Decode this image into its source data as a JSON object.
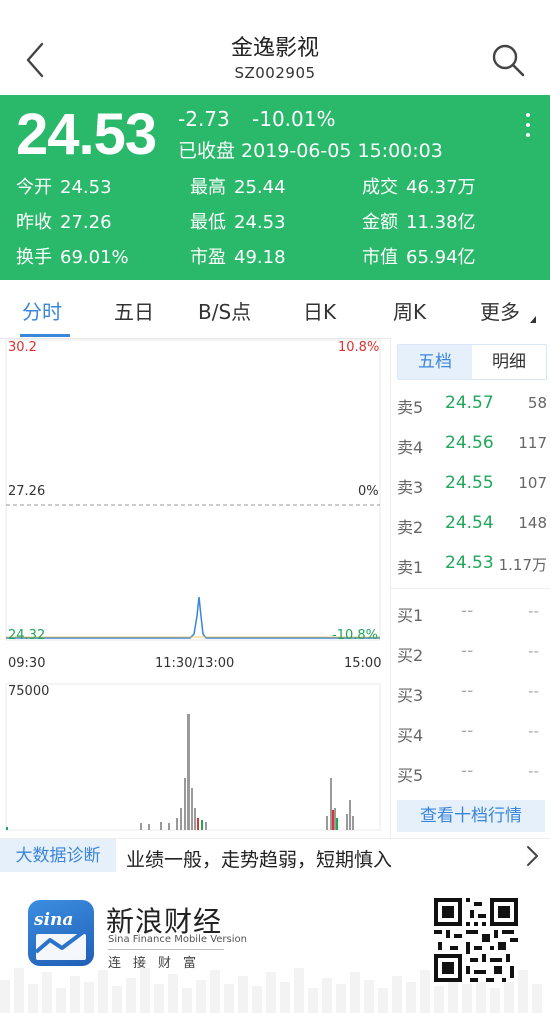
{
  "header": {
    "title": "金逸影视",
    "code": "SZ002905",
    "back_icon": "chevron-left-icon",
    "search_icon": "search-icon"
  },
  "quote": {
    "price": "24.53",
    "change": "-2.73",
    "change_pct": "-10.01%",
    "status": "已收盘 2019-06-05 15:00:03",
    "background": "#2ab86a",
    "stats": [
      {
        "label": "今开",
        "value": "24.53"
      },
      {
        "label": "最高",
        "value": "25.44"
      },
      {
        "label": "成交",
        "value": "46.37万"
      },
      {
        "label": "昨收",
        "value": "27.26"
      },
      {
        "label": "最低",
        "value": "24.53"
      },
      {
        "label": "金额",
        "value": "11.38亿"
      },
      {
        "label": "换手",
        "value": "69.01%"
      },
      {
        "label": "市盈",
        "value": "49.18"
      },
      {
        "label": "市值",
        "value": "65.94亿"
      }
    ]
  },
  "tabs": [
    "分时",
    "五日",
    "B/S点",
    "日K",
    "周K",
    "更多"
  ],
  "chart": {
    "price_high": "30.2",
    "pct_high": "10.8%",
    "price_mid": "27.26",
    "pct_mid": "0%",
    "price_low": "24.32",
    "pct_low": "-10.8%",
    "time_start": "09:30",
    "time_mid": "11:30/13:00",
    "time_end": "15:00",
    "volume_max": "75000"
  },
  "orderbook": {
    "tab_five": "五档",
    "tab_detail": "明细",
    "sells": [
      {
        "label": "卖5",
        "price": "24.57",
        "volume": "58"
      },
      {
        "label": "卖4",
        "price": "24.56",
        "volume": "117"
      },
      {
        "label": "卖3",
        "price": "24.55",
        "volume": "107"
      },
      {
        "label": "卖2",
        "price": "24.54",
        "volume": "148"
      },
      {
        "label": "卖1",
        "price": "24.53",
        "volume": "1.17万"
      }
    ],
    "buys": [
      {
        "label": "买1",
        "price": "--",
        "volume": "--"
      },
      {
        "label": "买2",
        "price": "--",
        "volume": "--"
      },
      {
        "label": "买3",
        "price": "--",
        "volume": "--"
      },
      {
        "label": "买4",
        "price": "--",
        "volume": "--"
      },
      {
        "label": "买5",
        "price": "--",
        "volume": "--"
      }
    ],
    "ten_button": "查看十档行情"
  },
  "diagnosis": {
    "tag": "大数据诊断",
    "text": "业绩一般，走势趋弱，短期慎入"
  },
  "footer": {
    "logo_text": "sina",
    "brand": "新浪财经",
    "brand_en": "Sina Finance Mobile Version",
    "brand_sub": "连接财富"
  },
  "colors": {
    "up": "#e03030",
    "down": "#1ea85a",
    "accent": "#3b86d8"
  }
}
